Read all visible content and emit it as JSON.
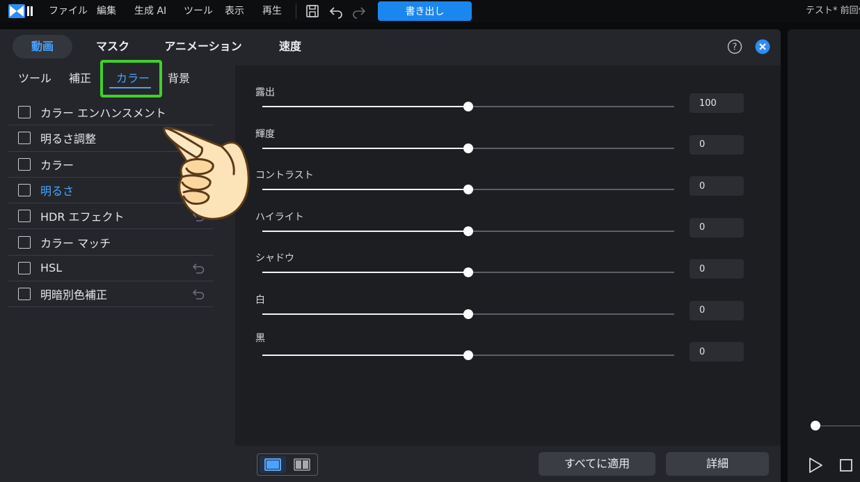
{
  "menubar": {
    "items": [
      "ファイル",
      "編集",
      "生成 AI",
      "ツール",
      "表示",
      "再生"
    ],
    "export_label": "書き出し",
    "project_title": "テスト* 前回保"
  },
  "main_tabs": [
    {
      "label": "動画",
      "active": true
    },
    {
      "label": "マスク",
      "active": false
    },
    {
      "label": "アニメーション",
      "active": false
    },
    {
      "label": "速度",
      "active": false
    }
  ],
  "sub_tabs": [
    {
      "label": "ツール",
      "active": false
    },
    {
      "label": "補正",
      "active": false
    },
    {
      "label": "カラー",
      "active": true
    },
    {
      "label": "背景",
      "active": false
    }
  ],
  "options": [
    {
      "label": "カラー エンハンスメント",
      "highlight": false,
      "reset": false
    },
    {
      "label": "明るさ調整",
      "highlight": false,
      "reset": false
    },
    {
      "label": "カラー",
      "highlight": false,
      "reset": false
    },
    {
      "label": "明るさ",
      "highlight": true,
      "reset": true
    },
    {
      "label": "HDR エフェクト",
      "highlight": false,
      "reset": true
    },
    {
      "label": "カラー マッチ",
      "highlight": false,
      "reset": false
    },
    {
      "label": "HSL",
      "highlight": false,
      "reset": true
    },
    {
      "label": "明暗別色補正",
      "highlight": false,
      "reset": true
    }
  ],
  "sliders": [
    {
      "label": "露出",
      "value": "100",
      "fraction": 0.5
    },
    {
      "label": "輝度",
      "value": "0",
      "fraction": 0.5
    },
    {
      "label": "コントラスト",
      "value": "0",
      "fraction": 0.5
    },
    {
      "label": "ハイライト",
      "value": "0",
      "fraction": 0.5
    },
    {
      "label": "シャドウ",
      "value": "0",
      "fraction": 0.5
    },
    {
      "label": "白",
      "value": "0",
      "fraction": 0.5
    },
    {
      "label": "黒",
      "value": "0",
      "fraction": 0.5
    }
  ],
  "bottom": {
    "apply_all_label": "すべてに適用",
    "detail_label": "詳細"
  },
  "colors": {
    "accent": "#4aa3ff",
    "export_button": "#1a86f0",
    "highlight_box": "#3fd22a"
  }
}
